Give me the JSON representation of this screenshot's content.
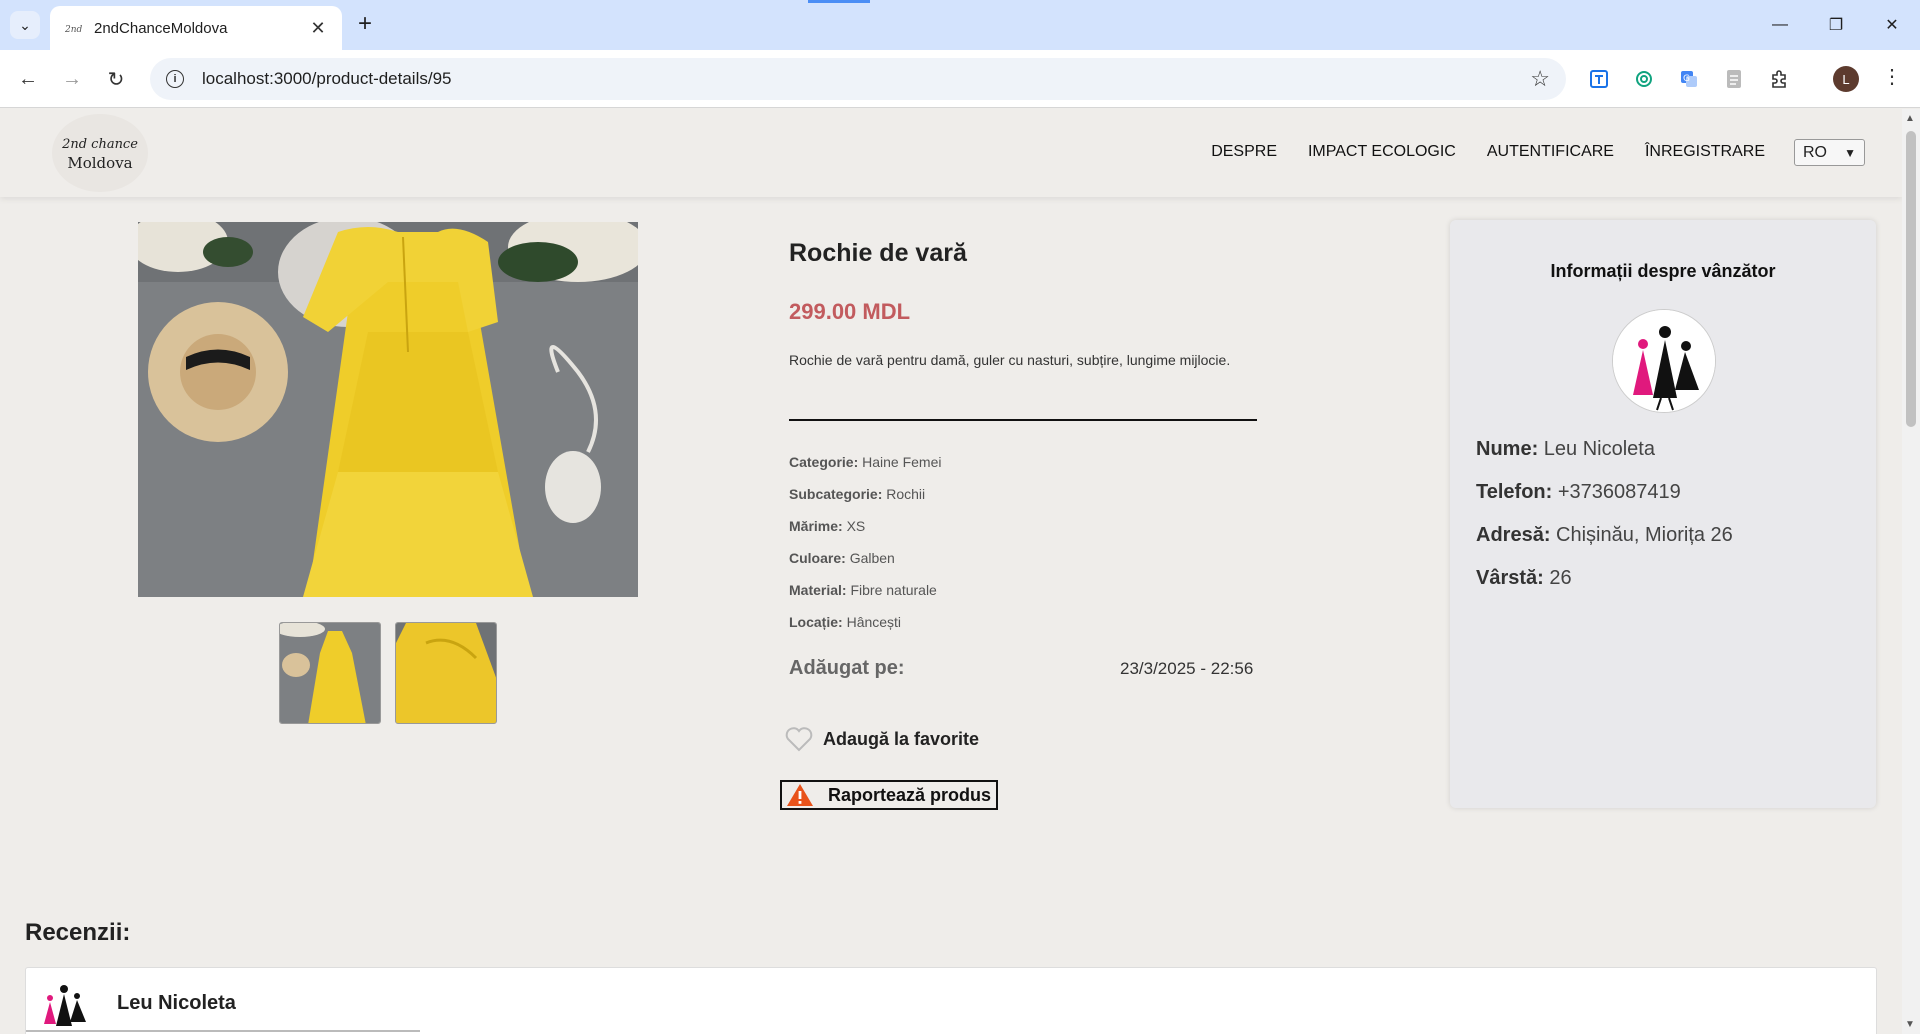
{
  "browser": {
    "tab_title": "2ndChanceMoldova",
    "url": "localhost:3000/product-details/95",
    "profile_initial": "L"
  },
  "site": {
    "logo_top": "2nd chance",
    "logo_bottom": "Moldova",
    "nav": [
      "DESPRE",
      "IMPACT ECOLOGIC",
      "AUTENTIFICARE",
      "ÎNREGISTRARE"
    ],
    "language": "RO"
  },
  "product": {
    "title": "Rochie de vară",
    "price": "299.00 MDL",
    "description": "Rochie de vară pentru damă, guler cu nasturi, subțire, lungime mijlocie.",
    "attributes": [
      {
        "label": "Categorie:",
        "value": "Haine Femei"
      },
      {
        "label": "Subcategorie:",
        "value": "Rochii"
      },
      {
        "label": "Mărime:",
        "value": "XS"
      },
      {
        "label": "Culoare:",
        "value": "Galben"
      },
      {
        "label": "Material:",
        "value": "Fibre naturale"
      },
      {
        "label": "Locație:",
        "value": "Hâncești"
      }
    ],
    "added_label": "Adăugat pe:",
    "added_value": "23/3/2025 - 22:56",
    "favorite_label": "Adaugă la favorite",
    "report_label": "Raportează produs"
  },
  "seller": {
    "heading": "Informații despre vânzător",
    "rows": [
      {
        "label": "Nume:",
        "value": "Leu Nicoleta"
      },
      {
        "label": "Telefon:",
        "value": "+3736087419"
      },
      {
        "label": "Adresă:",
        "value": "Chișinău, Miorița 26"
      },
      {
        "label": "Vârstă:",
        "value": "26"
      }
    ]
  },
  "reviews": {
    "heading": "Recenzii:",
    "items": [
      {
        "author": "Leu Nicoleta"
      }
    ]
  },
  "colors": {
    "price": "#c25b5e",
    "page_bg": "#efedea",
    "tabbar_bg": "#d3e3fd",
    "report_icon": "#e8531b"
  },
  "icons": [
    "chevron-down-icon",
    "close-icon",
    "plus-icon",
    "back-icon",
    "forward-icon",
    "reload-icon",
    "info-icon",
    "star-icon",
    "heart-icon",
    "warning-icon",
    "menu-dots-icon"
  ]
}
